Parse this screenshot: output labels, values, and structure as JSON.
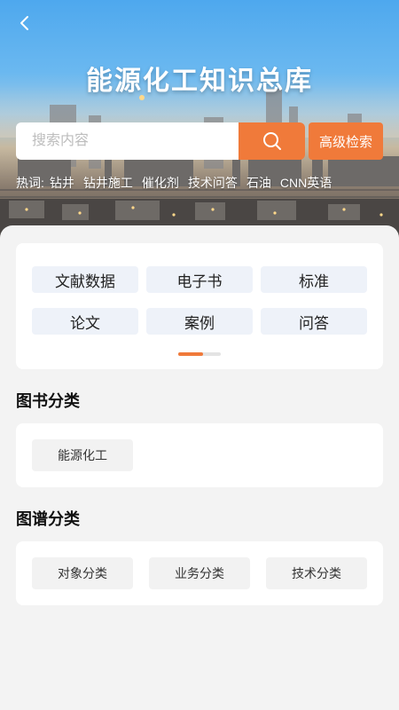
{
  "header": {
    "title": "能源化工知识总库",
    "back_icon": "chevron-left-icon"
  },
  "search": {
    "placeholder": "搜索内容",
    "value": "",
    "search_icon": "search-icon",
    "advanced_label": "高级检索"
  },
  "hot": {
    "label": "热词:",
    "tags": [
      "钻井",
      "钻井施工",
      "催化剂",
      "技术问答",
      "石油",
      "CNN英语"
    ]
  },
  "categories": {
    "items": [
      "文献数据",
      "电子书",
      "标准",
      "论文",
      "案例",
      "问答"
    ]
  },
  "book_section": {
    "title": "图书分类",
    "items": [
      "能源化工"
    ]
  },
  "graph_section": {
    "title": "图谱分类",
    "items": [
      "对象分类",
      "业务分类",
      "技术分类"
    ]
  },
  "colors": {
    "accent": "#f07a3a",
    "chip_bg": "#eef2f9",
    "page_bg": "#f3f3f3"
  }
}
